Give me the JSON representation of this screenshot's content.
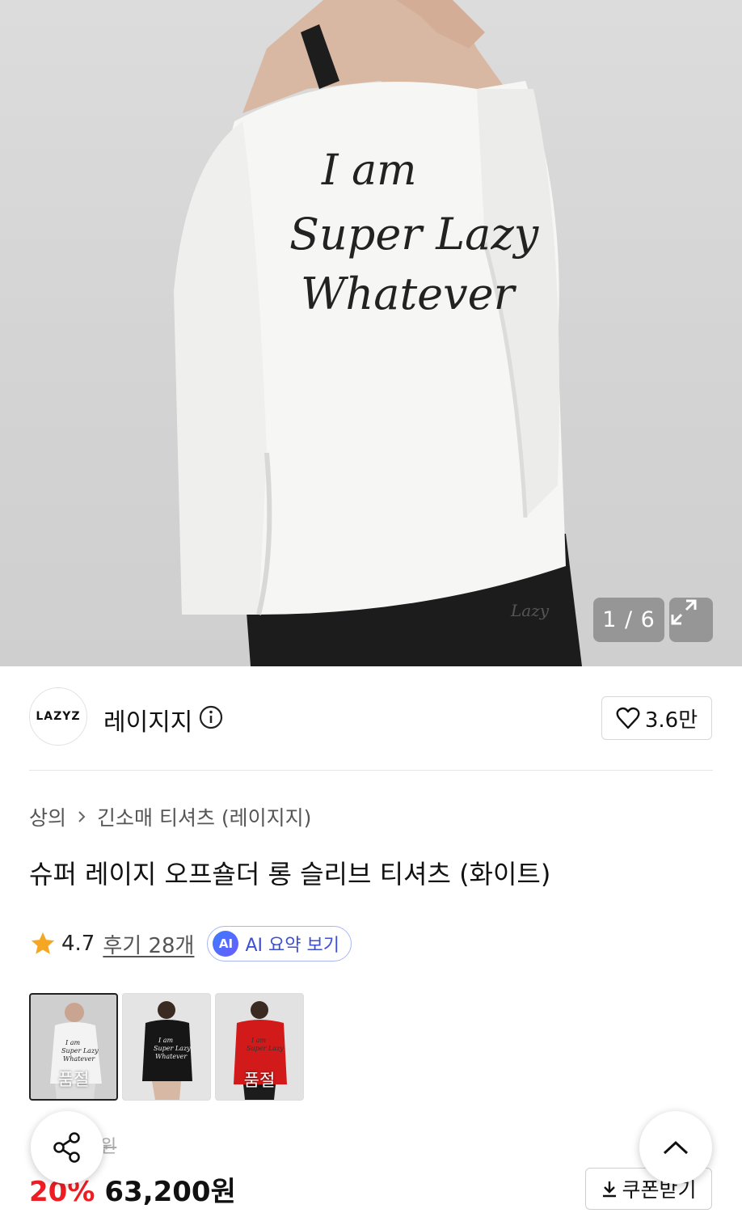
{
  "gallery": {
    "counter": "1 / 6",
    "expand_icon": "expand-icon"
  },
  "brand": {
    "logo_text": "LAZYZ",
    "name": "레이지지",
    "info_icon": "info-icon",
    "like_count": "3.6만",
    "like_icon": "heart-icon"
  },
  "breadcrumb": {
    "items": [
      "상의",
      "긴소매 티셔츠 (레이지지)"
    ],
    "separator_icon": "chevron-right-icon"
  },
  "product": {
    "title": "슈퍼 레이지 오프숄더 롱 슬리브 티셔츠 (화이트)"
  },
  "rating": {
    "star_icon": "star-icon",
    "value": "4.7",
    "reviews": "후기 28개",
    "ai_badge": "AI",
    "ai_label": "AI 요약 보기",
    "star_color": "#f5a623"
  },
  "variants": [
    {
      "color": "white",
      "label": "품절",
      "selected": true
    },
    {
      "color": "black",
      "label": "",
      "selected": false
    },
    {
      "color": "red",
      "label": "품절",
      "selected": false
    }
  ],
  "price": {
    "original_suffix": "원",
    "discount": "20%",
    "final": "63,200원",
    "discount_color": "#ee1d23",
    "coupon_label": "쿠폰받기",
    "coupon_icon": "download-icon"
  },
  "floating": {
    "share_icon": "share-icon",
    "top_icon": "chevron-up-icon"
  }
}
